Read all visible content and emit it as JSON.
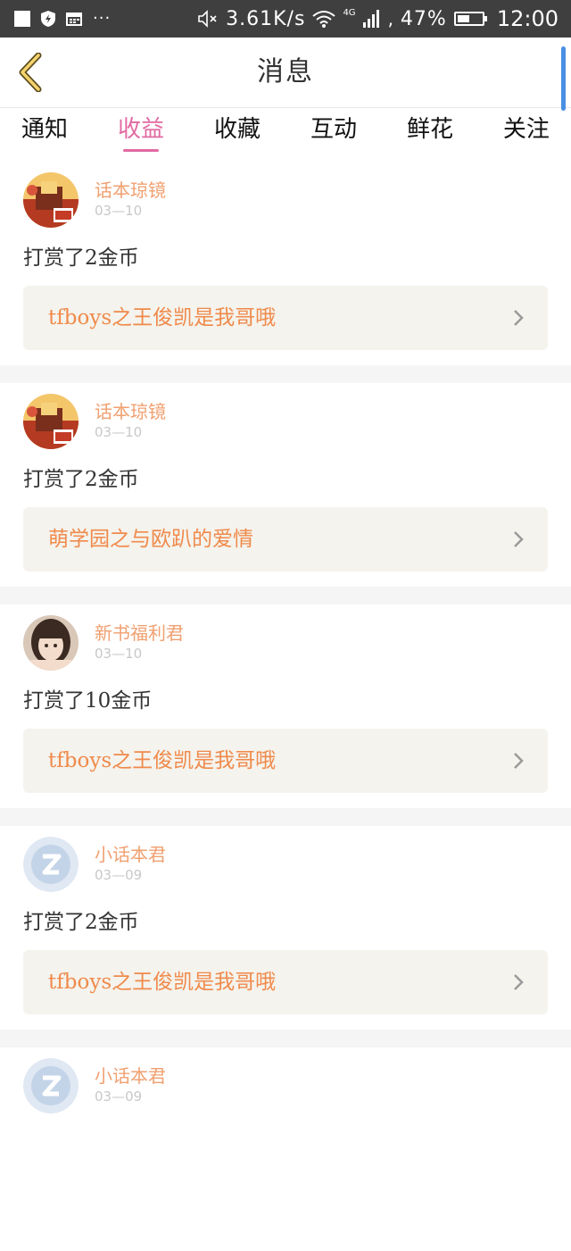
{
  "status_bar": {
    "dots": "···",
    "net_speed": "3.61K/s",
    "network_type": "4G",
    "separator": ",",
    "battery": "47%",
    "time": "12:00"
  },
  "header": {
    "title": "消息",
    "back_icon": "chevron-left-icon"
  },
  "tabs": [
    {
      "label": "通知"
    },
    {
      "label": "收益"
    },
    {
      "label": "收藏"
    },
    {
      "label": "互动"
    },
    {
      "label": "鲜花"
    },
    {
      "label": "关注"
    }
  ],
  "active_tab": "收益",
  "messages": [
    {
      "user": "话本琼镜",
      "date": "03—10",
      "action": "打赏了2金币",
      "book": "tfboys之王俊凯是我哥哦"
    },
    {
      "user": "话本琼镜",
      "date": "03—10",
      "action": "打赏了2金币",
      "book": "萌学园之与欧趴的爱情"
    },
    {
      "user": "新书福利君",
      "date": "03—10",
      "action": "打赏了10金币",
      "book": "tfboys之王俊凯是我哥哦"
    },
    {
      "user": "小话本君",
      "date": "03—09",
      "action": "打赏了2金币",
      "book": "tfboys之王俊凯是我哥哦"
    },
    {
      "user": "小话本君",
      "date": "03—09",
      "action": "",
      "book": ""
    }
  ],
  "colors": {
    "accent": "#e26aa2",
    "name": "#f0a070",
    "book": "#f08a4b",
    "status_bar": "#3f3f3f"
  }
}
